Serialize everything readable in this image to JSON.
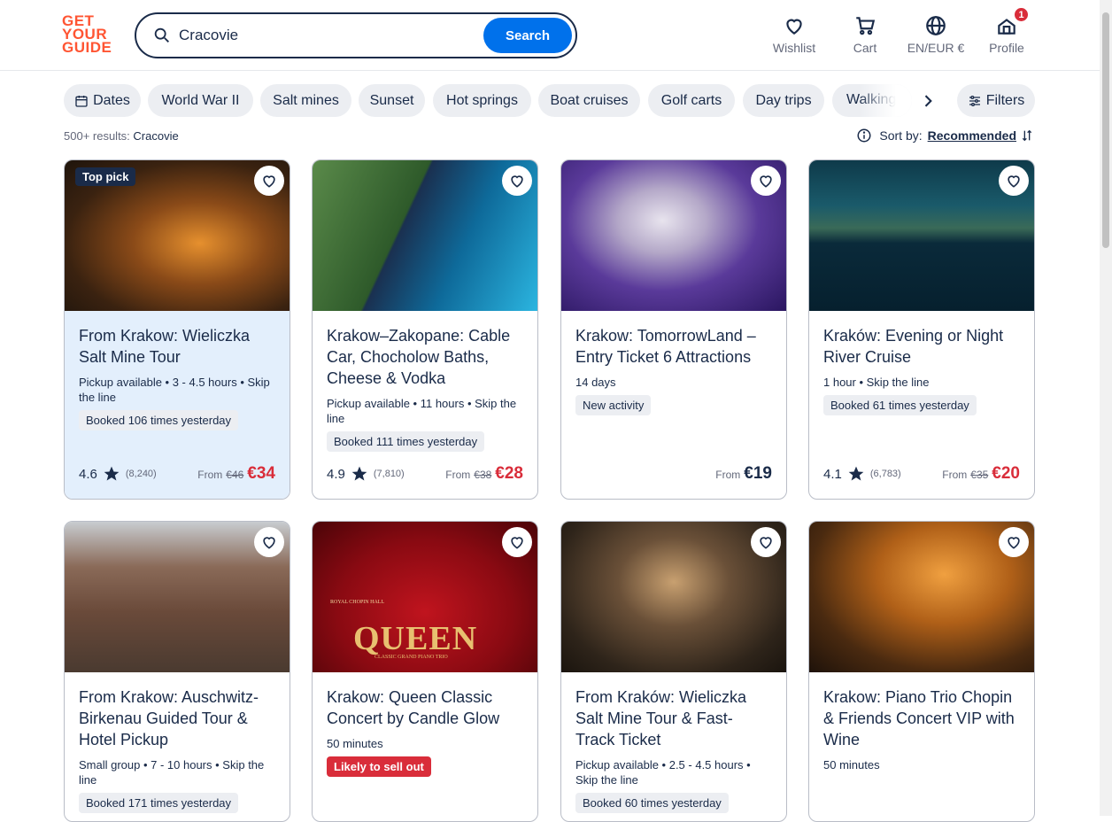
{
  "header": {
    "logo": [
      "GET",
      "YOUR",
      "GUIDE"
    ],
    "search_value": "Cracovie",
    "search_button": "Search",
    "nav": {
      "wishlist": "Wishlist",
      "cart": "Cart",
      "language": "EN/EUR €",
      "profile": "Profile",
      "profile_badge": "1"
    }
  },
  "chips": {
    "dates": "Dates",
    "items": [
      "World War II",
      "Salt mines",
      "Sunset",
      "Hot springs",
      "Boat cruises",
      "Golf carts",
      "Day trips"
    ],
    "cut_item": "Walking to",
    "filters": "Filters"
  },
  "results": {
    "prefix": "500+ results:",
    "query": "Cracovie"
  },
  "sort": {
    "label": "Sort by:",
    "value": "Recommended"
  },
  "colors": {
    "accent": "#0071eb",
    "brand": "#ff5533",
    "sale": "#d92d3a",
    "highlight": "#e3effc"
  },
  "cards": [
    {
      "title": "From Krakow: Wieliczka Salt Mine Tour",
      "meta": "Pickup available • 3 - 4.5 hours • Skip the line",
      "badge": "Booked 106 times yesterday",
      "rating": "4.6",
      "reviews": "(8,240)",
      "from": "From",
      "old_price": "€46",
      "price": "€34",
      "top_pick": "Top pick"
    },
    {
      "title": "Krakow–Zakopane: Cable Car, Chocholow Baths, Cheese & Vodka",
      "meta": "Pickup available • 11 hours • Skip the line",
      "badge": "Booked 111 times yesterday",
      "rating": "4.9",
      "reviews": "(7,810)",
      "from": "From",
      "old_price": "€38",
      "price": "€28"
    },
    {
      "title": "Krakow: TomorrowLand – Entry Ticket 6 Attractions",
      "meta": "14 days",
      "badge": "New activity",
      "from": "From",
      "price": "€19"
    },
    {
      "title": "Kraków: Evening or Night River Cruise",
      "meta": "1 hour • Skip the line",
      "badge": "Booked 61 times yesterday",
      "rating": "4.1",
      "reviews": "(6,783)",
      "from": "From",
      "old_price": "€35",
      "price": "€20"
    },
    {
      "title": "From Krakow: Auschwitz-Birkenau Guided Tour & Hotel Pickup",
      "meta": "Small group • 7 - 10 hours • Skip the line",
      "badge": "Booked 171 times yesterday"
    },
    {
      "title": "Krakow: Queen Classic Concert by Candle Glow",
      "meta": "50 minutes",
      "badge": "Likely to sell out",
      "img_text": "QUEEN",
      "img_sub": "CLASSIC GRAND PIANO TRIO",
      "img_top": "ROYAL CHOPIN HALL"
    },
    {
      "title": "From Kraków: Wieliczka Salt Mine Tour & Fast-Track Ticket",
      "meta": "Pickup available • 2.5 - 4.5 hours • Skip the line",
      "badge": "Booked 60 times yesterday"
    },
    {
      "title": "Krakow: Piano Trio Chopin & Friends Concert VIP with Wine",
      "meta": "50 minutes"
    }
  ]
}
